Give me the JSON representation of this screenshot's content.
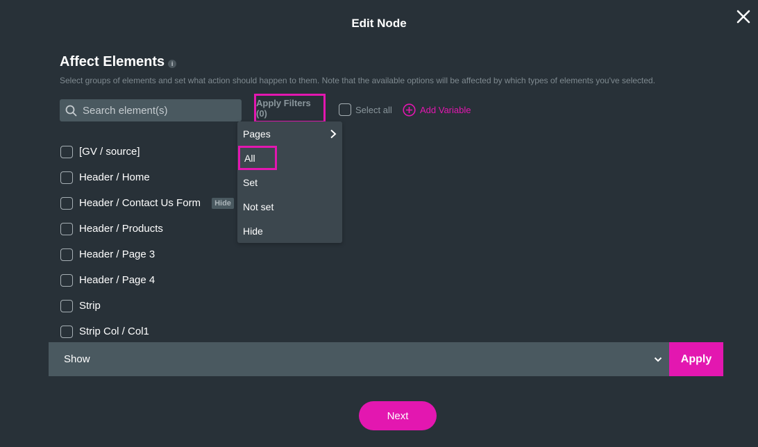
{
  "modal": {
    "title": "Edit Node",
    "close_icon": "close-icon"
  },
  "section": {
    "title": "Affect Elements",
    "info_icon_glyph": "i",
    "description": "Select groups of elements and set what action should happen to them. Note that the available options will be affected by which types of elements you've selected."
  },
  "toolbar": {
    "search_placeholder": "Search element(s)",
    "search_value": "",
    "apply_filters_label": "Apply Filters (0)",
    "select_all_label": "Select all",
    "add_variable_label": "Add Variable"
  },
  "filter_menu": {
    "items": [
      {
        "label": "Pages",
        "has_submenu": true
      },
      {
        "label": "All",
        "highlighted": true
      },
      {
        "label": "Set"
      },
      {
        "label": "Not set"
      },
      {
        "label": "Hide"
      }
    ]
  },
  "elements": [
    {
      "label": "[GV / source]",
      "checked": false
    },
    {
      "label": "Header / Home",
      "checked": false
    },
    {
      "label": "Header / Contact Us Form",
      "checked": false,
      "tag": "Hide"
    },
    {
      "label": "Header / Products",
      "checked": false
    },
    {
      "label": "Header / Page 3",
      "checked": false
    },
    {
      "label": "Header / Page 4",
      "checked": false
    },
    {
      "label": "Strip",
      "checked": false
    },
    {
      "label": "Strip Col / Col1",
      "checked": false
    }
  ],
  "action": {
    "selected": "Show",
    "apply_label": "Apply"
  },
  "footer": {
    "next_label": "Next"
  },
  "colors": {
    "background": "#283138",
    "accent": "#e317b0",
    "input_bg": "#4a5960",
    "menu_bg": "#3c474e"
  }
}
